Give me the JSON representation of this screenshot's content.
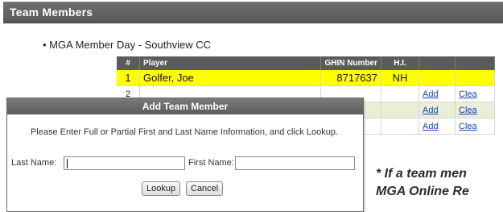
{
  "panel": {
    "title": "Team Members"
  },
  "event": {
    "text": "• MGA Member Day - Southview CC"
  },
  "table": {
    "headers": {
      "num": "#",
      "player": "Player",
      "ghin": "GHIN Number",
      "hi": "H.I.",
      "add": "",
      "clear": ""
    },
    "rows": [
      {
        "num": "1",
        "player": "Golfer, Joe",
        "ghin": "8717637",
        "hi": "NH",
        "add": "",
        "clear": ""
      },
      {
        "num": "2",
        "player": "",
        "ghin": "",
        "hi": "",
        "add": "Add",
        "clear": "Clea"
      },
      {
        "num": "",
        "player": "",
        "ghin": "",
        "hi": "",
        "add": "Add",
        "clear": "Clea"
      },
      {
        "num": "",
        "player": "",
        "ghin": "",
        "hi": "",
        "add": "Add",
        "clear": "Clea"
      }
    ]
  },
  "dialog": {
    "title": "Add Team Member",
    "instructions": "Please Enter Full or Partial First and Last Name Information, and click Lookup.",
    "last_name_label": "Last Name:",
    "last_name_value": "",
    "first_name_label": "First Name:",
    "first_name_value": "",
    "lookup_label": "Lookup",
    "cancel_label": "Cancel"
  },
  "footnote": {
    "line1": "* If a team men",
    "line2": "MGA Online Re"
  }
}
